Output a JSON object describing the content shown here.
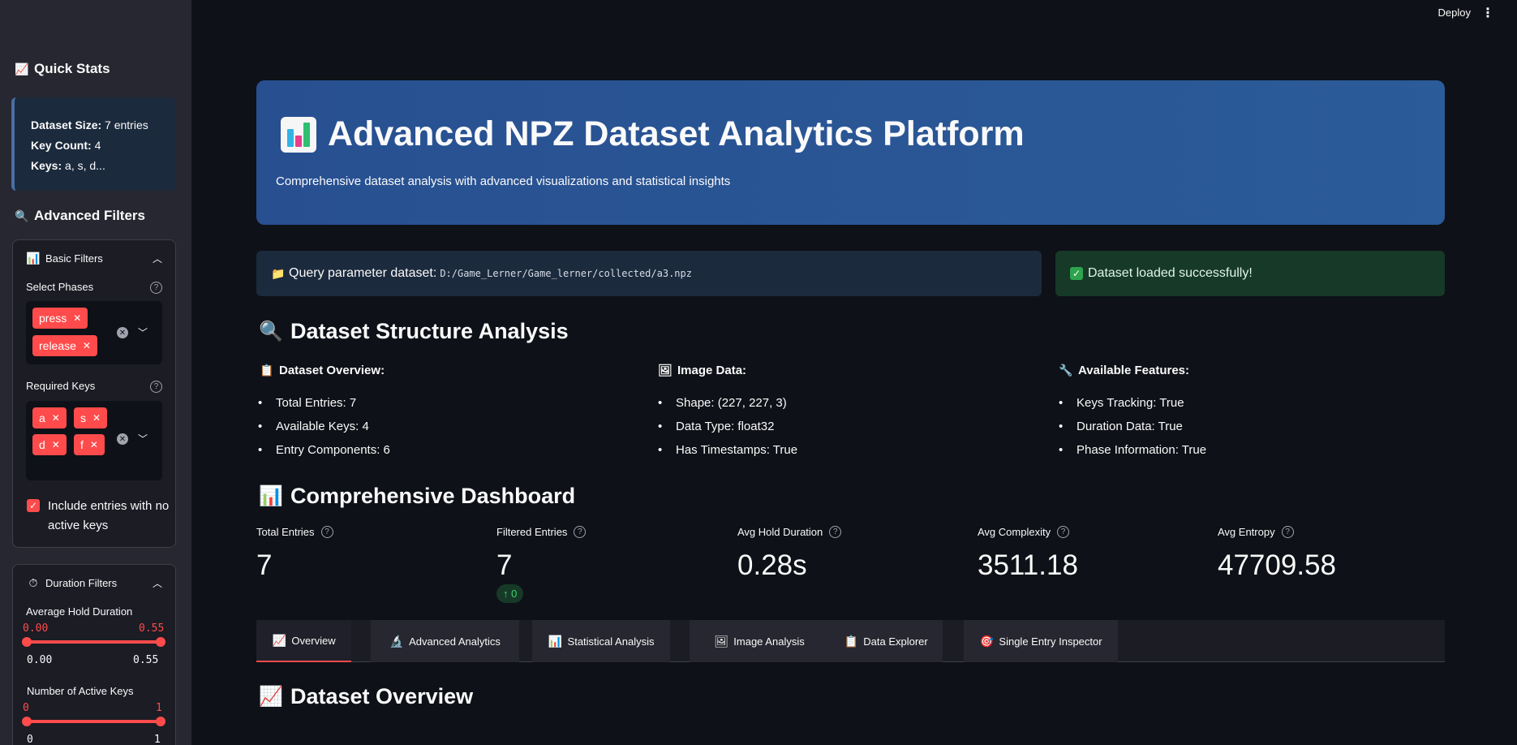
{
  "topbar": {
    "deploy_label": "Deploy",
    "menu_icon": "kebab-menu-icon"
  },
  "sidebar": {
    "quick_stats_title": "Quick Stats",
    "stats": {
      "dataset_size_label": "Dataset Size:",
      "dataset_size_value": "7 entries",
      "key_count_label": "Key Count:",
      "key_count_value": "4",
      "keys_label": "Keys:",
      "keys_value": "a, s, d..."
    },
    "advanced_filters_title": "Advanced Filters",
    "basic_filters": {
      "title": "Basic Filters",
      "select_phases_label": "Select Phases",
      "phases": [
        "press",
        "release"
      ],
      "required_keys_label": "Required Keys",
      "keys": [
        "a",
        "s",
        "d",
        "f"
      ],
      "include_checkbox_label": "Include entries with no active keys",
      "include_checked": true
    },
    "duration_filters": {
      "title": "Duration Filters",
      "avg_hold_label": "Average Hold Duration",
      "avg_hold_low": "0.00",
      "avg_hold_high": "0.55",
      "avg_hold_min": "0.00",
      "avg_hold_max": "0.55",
      "active_keys_label": "Number of Active Keys",
      "active_low": "0",
      "active_high": "1",
      "active_min": "0",
      "active_max": "1"
    }
  },
  "hero": {
    "title": "Advanced NPZ Dataset Analytics Platform",
    "subtitle": "Comprehensive dataset analysis with advanced visualizations and statistical insights"
  },
  "query_info": {
    "label": "Query parameter dataset:",
    "path": "D:/Game_Lerner/Game_lerner/collected/a3.npz"
  },
  "success_msg": "Dataset loaded successfully!",
  "structure": {
    "title": "Dataset Structure Analysis",
    "columns": [
      {
        "title": "Dataset Overview:",
        "items": [
          "Total Entries: 7",
          "Available Keys: 4",
          "Entry Components: 6"
        ]
      },
      {
        "title": "Image Data:",
        "items": [
          "Shape: (227, 227, 3)",
          "Data Type: float32",
          "Has Timestamps: True"
        ]
      },
      {
        "title": "Available Features:",
        "items": [
          "Keys Tracking: True",
          "Duration Data: True",
          "Phase Information: True"
        ]
      }
    ]
  },
  "dashboard": {
    "title": "Comprehensive Dashboard",
    "metrics": [
      {
        "label": "Total Entries",
        "value": "7"
      },
      {
        "label": "Filtered Entries",
        "value": "7",
        "delta": "0"
      },
      {
        "label": "Avg Hold Duration",
        "value": "0.28s"
      },
      {
        "label": "Avg Complexity",
        "value": "3511.18"
      },
      {
        "label": "Avg Entropy",
        "value": "47709.58"
      }
    ]
  },
  "tabs": [
    "Overview",
    "Advanced Analytics",
    "Statistical Analysis",
    "Image Analysis",
    "Data Explorer",
    "Single Entry Inspector"
  ],
  "active_tab": "Overview",
  "section_title": "Dataset Overview",
  "colors": {
    "accent": "#ff4b4b",
    "hero": "#285091",
    "success": "#173928",
    "info": "#1c2a3d",
    "background": "#0e1117",
    "sidebar": "#262730"
  }
}
